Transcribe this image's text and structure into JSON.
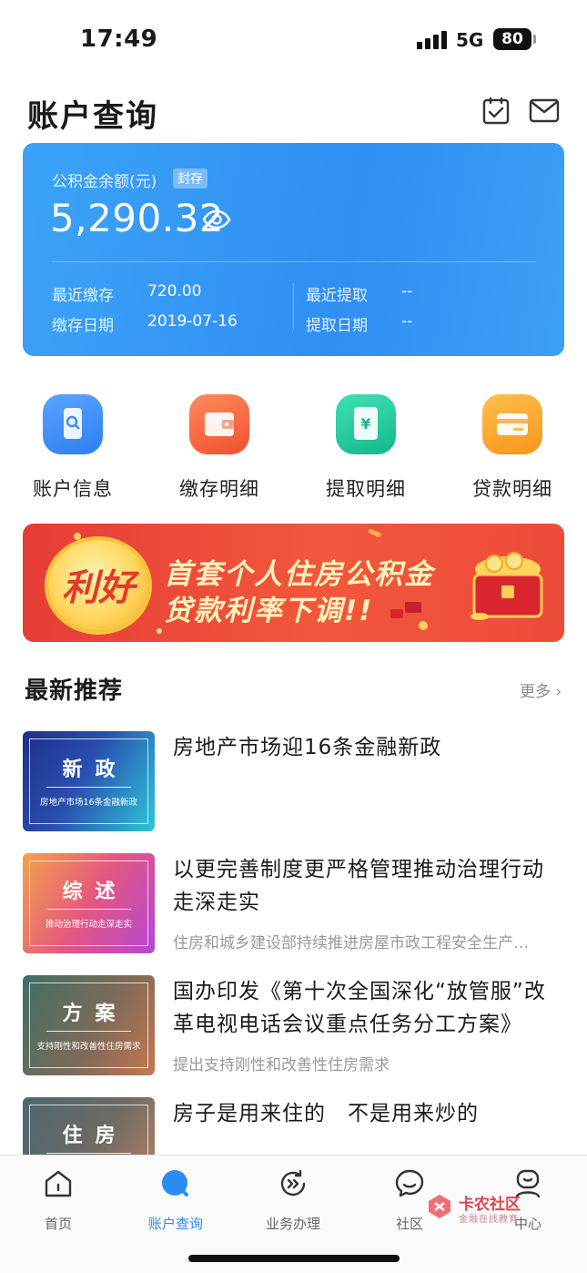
{
  "status_bar": {
    "time": "17:49",
    "network": "5G",
    "battery": "80"
  },
  "header": {
    "title": "账户查询",
    "icons": [
      "clipboard-check-icon",
      "mail-icon"
    ]
  },
  "balance": {
    "label": "公积金余额(元)",
    "badge": "封存",
    "amount": "5,290.32",
    "recent_deposit_label": "最近缴存",
    "recent_deposit_value": "720.00",
    "deposit_date_label": "缴存日期",
    "deposit_date_value": "2019-07-16",
    "recent_withdraw_label": "最近提取",
    "recent_withdraw_value": "--",
    "withdraw_date_label": "提取日期",
    "withdraw_date_value": "--"
  },
  "quick_actions": [
    {
      "label": "账户信息",
      "icon": "phone-search-icon",
      "color": "#3f8df5"
    },
    {
      "label": "缴存明细",
      "icon": "wallet-icon",
      "color": "#f4603e"
    },
    {
      "label": "提取明细",
      "icon": "yuan-receipt-icon",
      "color": "#22c59b"
    },
    {
      "label": "贷款明细",
      "icon": "card-icon",
      "color": "#f7a12a"
    }
  ],
  "banner": {
    "badge": "利好",
    "line1": "首套个人住房公积金",
    "line2": "贷款利率下调!!"
  },
  "section": {
    "title": "最新推荐",
    "more": "更多"
  },
  "news": [
    {
      "thumb_title": "新政",
      "thumb_sub": "房地产市场16条金融新政",
      "title": "房地产市场迎16条金融新政",
      "desc": ""
    },
    {
      "thumb_title": "综述",
      "thumb_sub": "推动治理行动走深走实",
      "title": "以更完善制度更严格管理推动治理行动走深走实",
      "desc": "住房和城乡建设部持续推进房屋市政工程安全生产…"
    },
    {
      "thumb_title": "方案",
      "thumb_sub": "支持刚性和改善性住房需求",
      "title": "国办印发《第十次全国深化“放管服”改革电视电话会议重点任务分工方案》",
      "desc": "提出支持刚性和改善性住房需求"
    },
    {
      "thumb_title": "住房",
      "thumb_sub": "",
      "title": "房子是用来住的　不是用来炒的",
      "desc": ""
    }
  ],
  "tabs": [
    {
      "label": "首页",
      "icon": "home-icon",
      "active": false
    },
    {
      "label": "账户查询",
      "icon": "account-search-icon",
      "active": true
    },
    {
      "label": "业务办理",
      "icon": "business-icon",
      "active": false
    },
    {
      "label": "社区",
      "icon": "chat-icon",
      "active": false
    },
    {
      "label": "中心",
      "icon": "profile-icon",
      "active": false
    }
  ],
  "watermark": {
    "title": "卡农社区",
    "sub": "金融在线教育"
  },
  "colors": {
    "accent": "#2a8cf0",
    "card": "#3398f5",
    "banner": "#ee4b3a"
  }
}
